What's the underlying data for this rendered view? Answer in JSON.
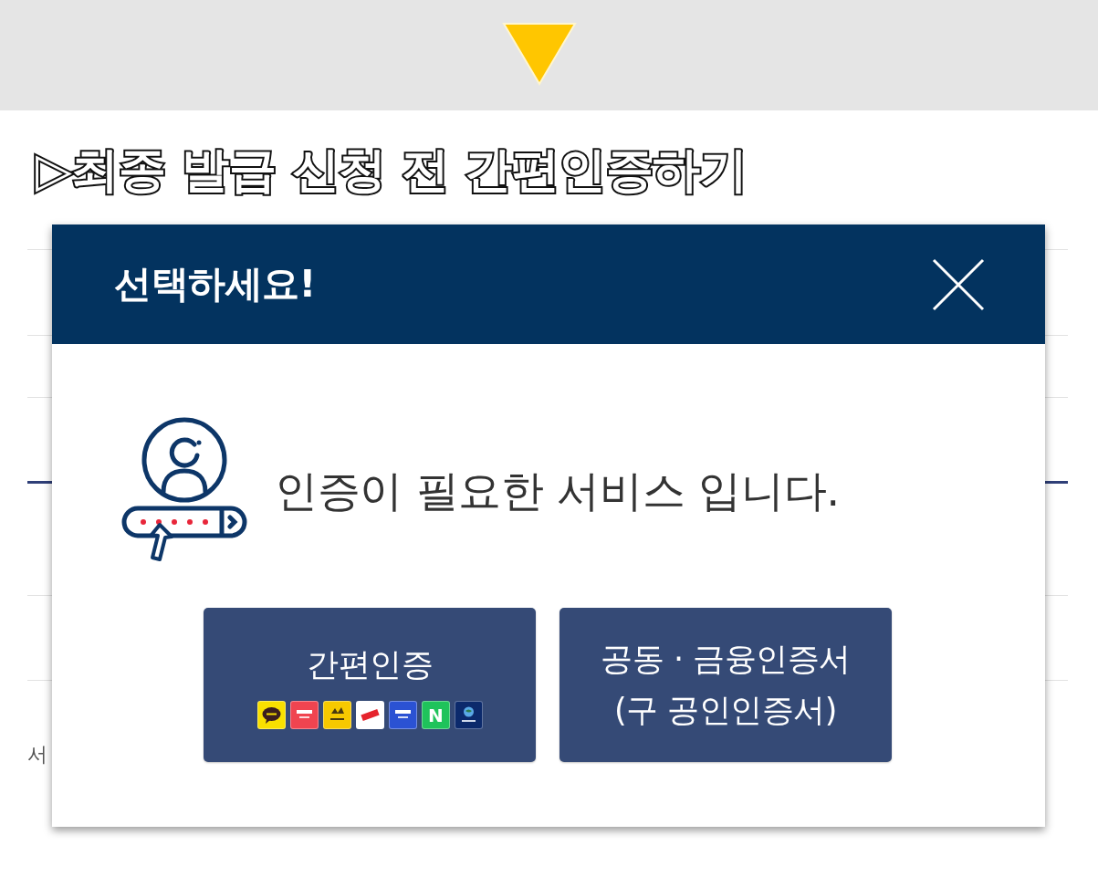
{
  "heading": "▷최종 발급 신청 전 간편인증하기",
  "background_page": {
    "label": "서"
  },
  "dialog": {
    "title": "선택하세요!",
    "message": "인증이 필요한 서비스 입니다.",
    "buttons": [
      {
        "kind": "simple",
        "lines": [
          "간편인증"
        ],
        "logos": [
          {
            "kind": "bubble",
            "color": "#f9e000"
          },
          {
            "kind": "wordmark",
            "color": "#f04450"
          },
          {
            "kind": "emblem",
            "color": "#f7c900"
          },
          {
            "kind": "tag",
            "color": "#ffffff"
          },
          {
            "kind": "wordmark",
            "color": "#2b52d3"
          },
          {
            "kind": "letter",
            "color": "#1fc35b",
            "text": "N"
          },
          {
            "kind": "globe",
            "color": "#0c2a6c"
          }
        ]
      },
      {
        "kind": "certificate",
        "lines": [
          "공동 · 금융인증서",
          "(구 공인인증서)"
        ]
      }
    ]
  }
}
